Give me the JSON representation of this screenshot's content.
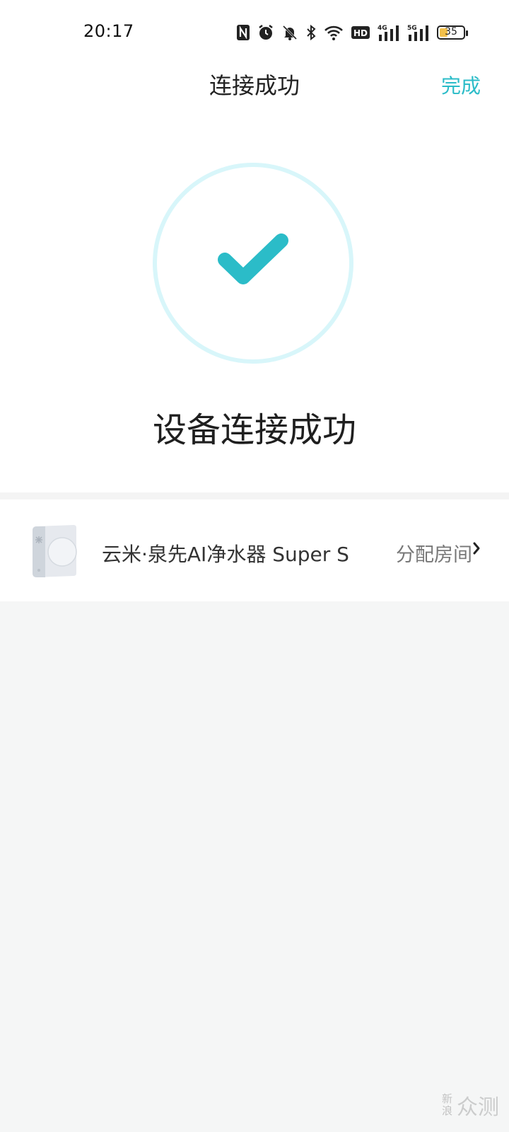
{
  "status_bar": {
    "time": "20:17",
    "icons": [
      "nfc-icon",
      "alarm-icon",
      "mute-icon",
      "bluetooth-icon",
      "wifi-icon",
      "hd-icon",
      "signal-4g-icon",
      "signal-5g-icon"
    ],
    "signal_4g_label": "4G",
    "signal_5g_label": "5G",
    "hd_label": "HD",
    "battery_level": "35",
    "battery_fraction": 0.35
  },
  "header": {
    "title": "连接成功",
    "done_label": "完成"
  },
  "success": {
    "message": "设备连接成功"
  },
  "device": {
    "name": "云米·泉先AI净水器 Super S",
    "action_label": "分配房间"
  },
  "watermark": {
    "small_top": "新",
    "small_bottom": "浪",
    "big": "众测"
  },
  "colors": {
    "accent": "#2bbcc8",
    "ring": "#d8f6fa",
    "background": "#f5f6f6"
  }
}
